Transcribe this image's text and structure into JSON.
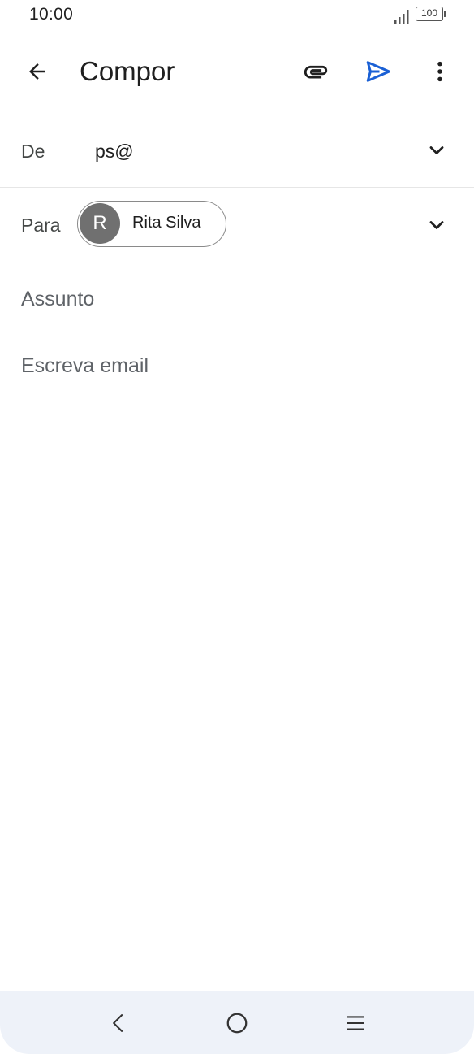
{
  "status_bar": {
    "time": "10:00",
    "battery": "100",
    "icons": [
      "signal-icon",
      "battery-icon"
    ]
  },
  "toolbar": {
    "title": "Compor",
    "icons": {
      "back": "arrow-back-icon",
      "attach": "paperclip-icon",
      "send": "send-icon",
      "more": "more-vert-icon"
    },
    "send_color": "#1a60d5"
  },
  "compose": {
    "from_label": "De",
    "from_value": "ps@",
    "to_label": "Para",
    "recipient": {
      "initial": "R",
      "name": "Rita Silva"
    },
    "subject_placeholder": "Assunto",
    "body_placeholder": "Escreva email"
  },
  "navigation_bar": {
    "icons": [
      "nav-back-icon",
      "nav-home-icon",
      "nav-menu-icon"
    ],
    "background": "#eef2f9"
  }
}
